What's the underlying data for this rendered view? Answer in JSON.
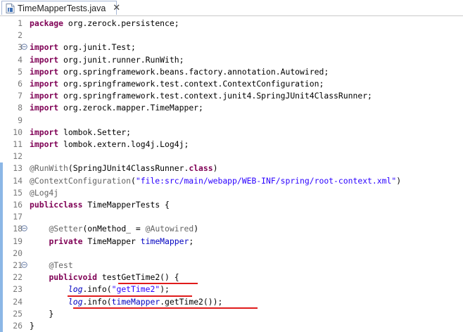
{
  "tab": {
    "title": "TimeMapperTests.java",
    "close": "✕",
    "icon": "java-file-icon"
  },
  "colors": {
    "keyword": "#7f0055",
    "annotation": "#646464",
    "string": "#2a00ff",
    "field": "#0000c0",
    "highlight_underline": "#e01b1b"
  },
  "lines": [
    {
      "n": "1",
      "tokens": [
        [
          "kw",
          "package"
        ],
        [
          "",
          "org.zerock.persistence;"
        ]
      ]
    },
    {
      "n": "2",
      "tokens": []
    },
    {
      "n": "3",
      "tokens": [
        [
          "kw",
          "import"
        ],
        [
          "",
          "org.junit.Test;"
        ]
      ]
    },
    {
      "n": "4",
      "tokens": [
        [
          "kw",
          "import"
        ],
        [
          "",
          "org.junit.runner.RunWith;"
        ]
      ]
    },
    {
      "n": "5",
      "tokens": [
        [
          "kw",
          "import"
        ],
        [
          "",
          "org.springframework.beans.factory.annotation.Autowired;"
        ]
      ]
    },
    {
      "n": "6",
      "tokens": [
        [
          "kw",
          "import"
        ],
        [
          "",
          "org.springframework.test.context.ContextConfiguration;"
        ]
      ]
    },
    {
      "n": "7",
      "tokens": [
        [
          "kw",
          "import"
        ],
        [
          "",
          "org.springframework.test.context.junit4.SpringJUnit4ClassRunner;"
        ]
      ]
    },
    {
      "n": "8",
      "tokens": [
        [
          "kw",
          "import"
        ],
        [
          "",
          "org.zerock.mapper.TimeMapper;"
        ]
      ]
    },
    {
      "n": "9",
      "tokens": []
    },
    {
      "n": "10",
      "tokens": [
        [
          "kw",
          "import"
        ],
        [
          "",
          "lombok.Setter;"
        ]
      ]
    },
    {
      "n": "11",
      "tokens": [
        [
          "kw",
          "import"
        ],
        [
          "",
          "lombok.extern.log4j.Log4j;"
        ]
      ]
    },
    {
      "n": "12",
      "tokens": []
    },
    {
      "n": "13",
      "tokens": [
        [
          "ann",
          "@RunWith"
        ],
        [
          "",
          "(SpringJUnit4ClassRunner."
        ],
        [
          "kw",
          "class"
        ],
        [
          "",
          ")"
        ]
      ]
    },
    {
      "n": "14",
      "tokens": [
        [
          "ann",
          "@ContextConfiguration"
        ],
        [
          "",
          "("
        ],
        [
          "str",
          "\"file:src/main/webapp/WEB-INF/spring/root-context.xml\""
        ],
        [
          "",
          ")"
        ]
      ]
    },
    {
      "n": "15",
      "tokens": [
        [
          "ann",
          "@Log4j"
        ]
      ]
    },
    {
      "n": "16",
      "tokens": [
        [
          "kw",
          "public"
        ],
        [
          "",
          ""
        ],
        [
          "kw",
          "class"
        ],
        [
          "",
          "TimeMapperTests {"
        ]
      ]
    },
    {
      "n": "17",
      "tokens": []
    },
    {
      "n": "18",
      "tokens": [
        [
          "",
          "    "
        ],
        [
          "ann",
          "@Setter"
        ],
        [
          "",
          "(onMethod_ = "
        ],
        [
          "ann",
          "@Autowired"
        ],
        [
          "",
          ")"
        ]
      ]
    },
    {
      "n": "19",
      "tokens": [
        [
          "",
          "    "
        ],
        [
          "kw",
          "private"
        ],
        [
          "",
          "TimeMapper "
        ],
        [
          "fld",
          "timeMapper"
        ],
        [
          "",
          ";"
        ]
      ]
    },
    {
      "n": "20",
      "tokens": []
    },
    {
      "n": "21",
      "tokens": [
        [
          "",
          "    "
        ],
        [
          "ann",
          "@Test"
        ]
      ]
    },
    {
      "n": "22",
      "tokens": [
        [
          "",
          "    "
        ],
        [
          "kw",
          "public"
        ],
        [
          "",
          ""
        ],
        [
          "kw",
          "void"
        ],
        [
          "",
          "testGetTime2() {"
        ]
      ]
    },
    {
      "n": "23",
      "tokens": [
        [
          "",
          "        "
        ],
        [
          "fld-i",
          "log"
        ],
        [
          "",
          ".info("
        ],
        [
          "str",
          "\"getTime2\""
        ],
        [
          "",
          ");"
        ]
      ]
    },
    {
      "n": "24",
      "tokens": [
        [
          "",
          "        "
        ],
        [
          "fld-i",
          "log"
        ],
        [
          "",
          ".info("
        ],
        [
          "fld",
          "timeMapper"
        ],
        [
          "",
          ".getTime2());"
        ]
      ]
    },
    {
      "n": "25",
      "tokens": [
        [
          "",
          "    }"
        ]
      ]
    },
    {
      "n": "26",
      "tokens": [
        [
          "",
          "}"
        ]
      ]
    }
  ]
}
